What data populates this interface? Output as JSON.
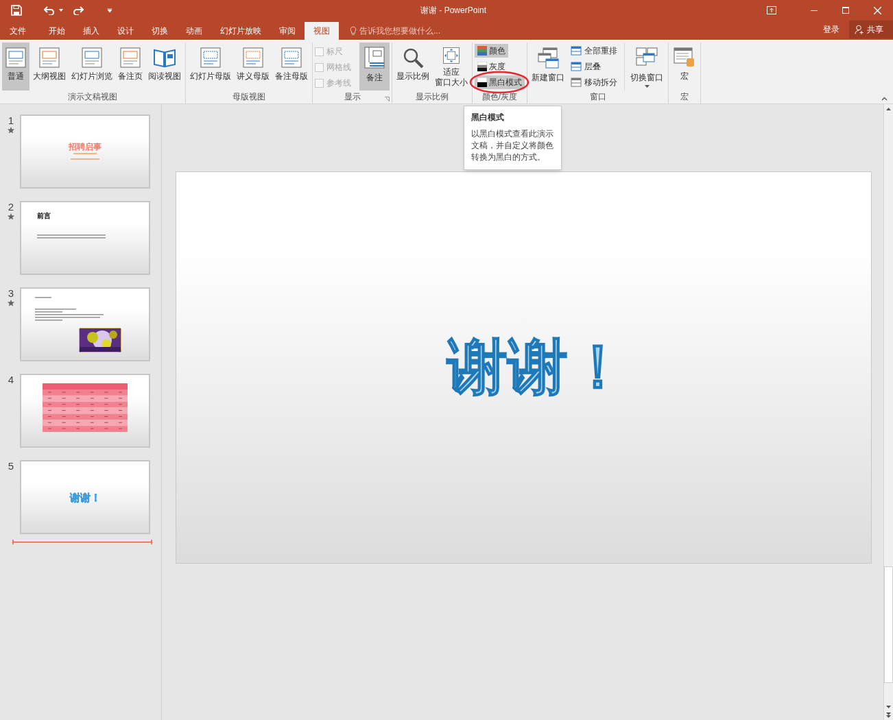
{
  "title_bar": {
    "title": "谢谢 - PowerPoint"
  },
  "tabs": [
    {
      "label": "文件",
      "selected": false
    },
    {
      "label": "开始",
      "selected": false
    },
    {
      "label": "插入",
      "selected": false
    },
    {
      "label": "设计",
      "selected": false
    },
    {
      "label": "切换",
      "selected": false
    },
    {
      "label": "动画",
      "selected": false
    },
    {
      "label": "幻灯片放映",
      "selected": false
    },
    {
      "label": "审阅",
      "selected": false
    },
    {
      "label": "视图",
      "selected": true
    }
  ],
  "tell_me": {
    "placeholder": "告诉我您想要做什么..."
  },
  "account": {
    "sign_in": "登录",
    "share": "共享"
  },
  "ribbon_groups": [
    {
      "kind": "large",
      "label": "演示文稿视图",
      "items": [
        {
          "label": "普通",
          "selected": true
        },
        {
          "label": "大纲视图",
          "selected": false
        },
        {
          "label": "幻灯片浏览",
          "selected": false
        },
        {
          "label": "备注页",
          "selected": false
        },
        {
          "label": "阅读视图",
          "selected": false
        }
      ]
    },
    {
      "kind": "large",
      "label": "母版视图",
      "items": [
        {
          "label": "幻灯片母版",
          "selected": false
        },
        {
          "label": "讲义母版",
          "selected": false
        },
        {
          "label": "备注母版",
          "selected": false
        }
      ]
    },
    {
      "kind": "show",
      "label": "显示",
      "checks": [
        {
          "label": "标尺",
          "checked": false,
          "disabled": true
        },
        {
          "label": "网格线",
          "checked": false,
          "disabled": true
        },
        {
          "label": "参考线",
          "checked": false,
          "disabled": true
        }
      ],
      "items": [
        {
          "label": "备注",
          "selected": true
        }
      ]
    },
    {
      "kind": "large",
      "label": "显示比例",
      "items": [
        {
          "label": "显示比例",
          "selected": false
        },
        {
          "lines": [
            "适应",
            "窗口大小"
          ],
          "selected": false
        }
      ]
    },
    {
      "kind": "color",
      "label": "颜色/灰度",
      "items": [
        {
          "label": "颜色",
          "selected": true,
          "circled": false
        },
        {
          "label": "灰度",
          "selected": false,
          "circled": false
        },
        {
          "label": "黑白模式",
          "selected": true,
          "circled": true
        }
      ]
    },
    {
      "kind": "window",
      "label": "窗口",
      "items": [
        {
          "label": "新建窗口",
          "selected": false
        }
      ],
      "small": [
        "全部重排",
        "层叠",
        "移动拆分"
      ],
      "switch": "切换窗口"
    },
    {
      "kind": "large",
      "label": "宏",
      "items": [
        {
          "label": "宏",
          "selected": false
        }
      ]
    }
  ],
  "tooltip": {
    "title": "黑白模式",
    "text": "以黑白模式查看此演示文稿，并自定义将颜色转换为黑白的方式。"
  },
  "slides": [
    {
      "number": "1",
      "animated": true,
      "kind": "title",
      "title": "招聘启事"
    },
    {
      "number": "2",
      "animated": true,
      "kind": "text",
      "title": "前言"
    },
    {
      "number": "3",
      "animated": true,
      "kind": "bullets"
    },
    {
      "number": "4",
      "animated": false,
      "kind": "table"
    },
    {
      "number": "5",
      "animated": false,
      "kind": "closing",
      "title": "谢谢！"
    }
  ],
  "current_slide": {
    "title": "谢谢！"
  }
}
